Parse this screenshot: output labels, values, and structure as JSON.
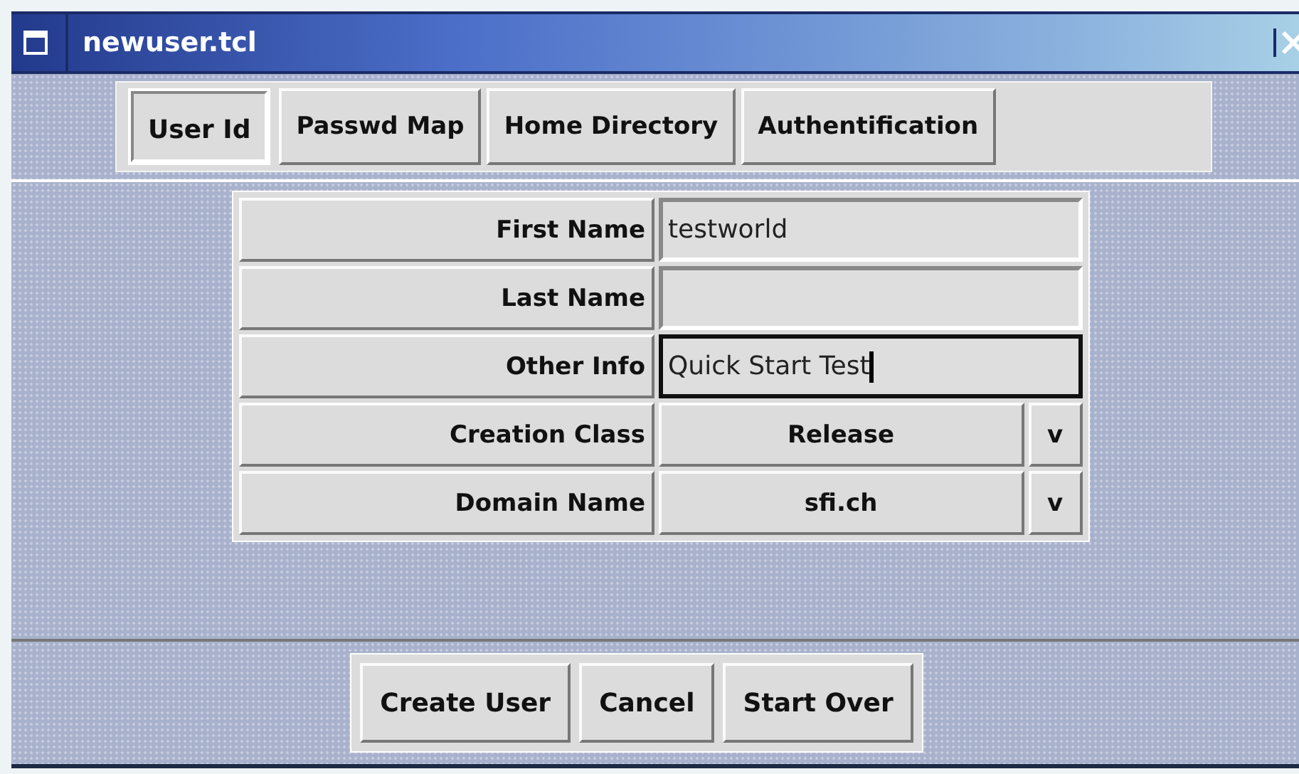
{
  "window": {
    "title": "newuser.tcl"
  },
  "tabs": [
    {
      "label": "User Id",
      "selected": true
    },
    {
      "label": "Passwd Map",
      "selected": false
    },
    {
      "label": "Home Directory",
      "selected": false
    },
    {
      "label": "Authentification",
      "selected": false
    }
  ],
  "form": [
    {
      "kind": "text",
      "label": "First Name",
      "value": "testworld",
      "focused": false
    },
    {
      "kind": "text",
      "label": "Last Name",
      "focused": false
    },
    {
      "kind": "text",
      "label": "Other Info",
      "value": "Quick Start Test",
      "focused": true
    },
    {
      "kind": "menu",
      "label": "Creation Class",
      "value": "Release",
      "arrow": "v"
    },
    {
      "kind": "menu",
      "label": "Domain Name",
      "value": "sfi.ch",
      "arrow": "v"
    }
  ],
  "buttons": [
    "Create User",
    "Cancel",
    "Start Over"
  ]
}
